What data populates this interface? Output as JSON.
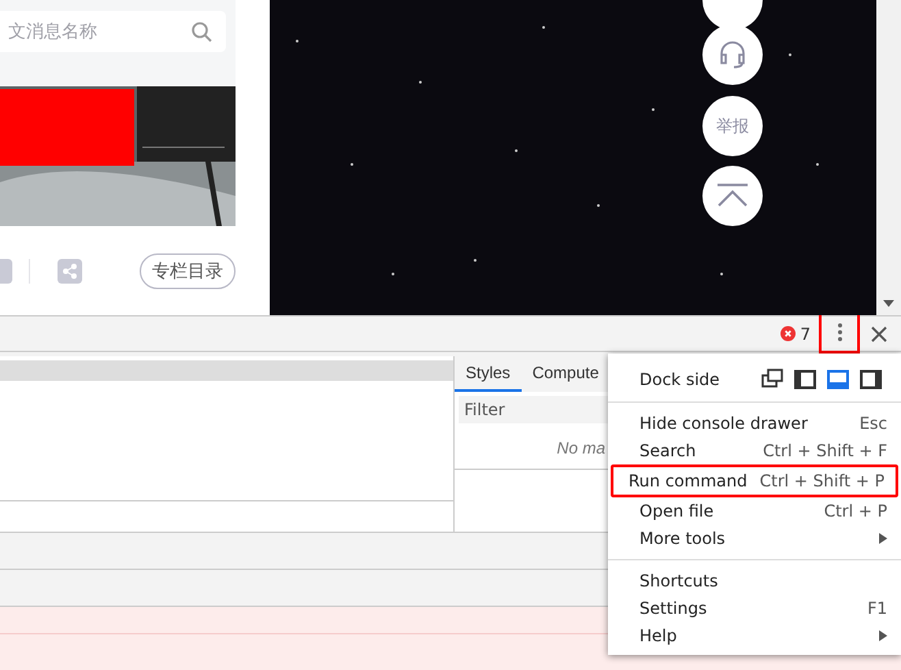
{
  "page": {
    "search": {
      "placeholder": "文消息名称"
    },
    "catalog_button": "专栏目录",
    "float_buttons": [
      {
        "kind": "blank"
      },
      {
        "kind": "headset"
      },
      {
        "kind": "text",
        "label": "举报"
      },
      {
        "kind": "top"
      }
    ]
  },
  "devtools": {
    "error_count": "7",
    "menu_button": {
      "highlighted": true
    },
    "sidebar_tabs": [
      {
        "label": "Styles",
        "selected": true
      },
      {
        "label": "Compute",
        "selected": false
      }
    ],
    "filter": {
      "placeholder": "Filter"
    },
    "styles_message": "No ma",
    "menu": {
      "dock_label": "Dock side",
      "dock_options": [
        {
          "kind": "undock",
          "selected": false
        },
        {
          "kind": "left",
          "selected": false
        },
        {
          "kind": "bottom",
          "selected": true
        },
        {
          "kind": "right",
          "selected": false
        }
      ],
      "sections": [
        [
          {
            "label": "Hide console drawer",
            "shortcut": "Esc",
            "submenu": false,
            "highlighted": false
          },
          {
            "label": "Search",
            "shortcut": "Ctrl + Shift + F",
            "submenu": false,
            "highlighted": false
          },
          {
            "label": "Run command",
            "shortcut": "Ctrl + Shift + P",
            "submenu": false,
            "highlighted": true
          },
          {
            "label": "Open file",
            "shortcut": "Ctrl + P",
            "submenu": false,
            "highlighted": false
          },
          {
            "label": "More tools",
            "submenu": true,
            "highlighted": false
          }
        ],
        [
          {
            "label": "Shortcuts",
            "submenu": false,
            "highlighted": false
          },
          {
            "label": "Settings",
            "shortcut": "F1",
            "submenu": false,
            "highlighted": false
          },
          {
            "label": "Help",
            "submenu": true,
            "highlighted": false
          }
        ]
      ]
    }
  }
}
